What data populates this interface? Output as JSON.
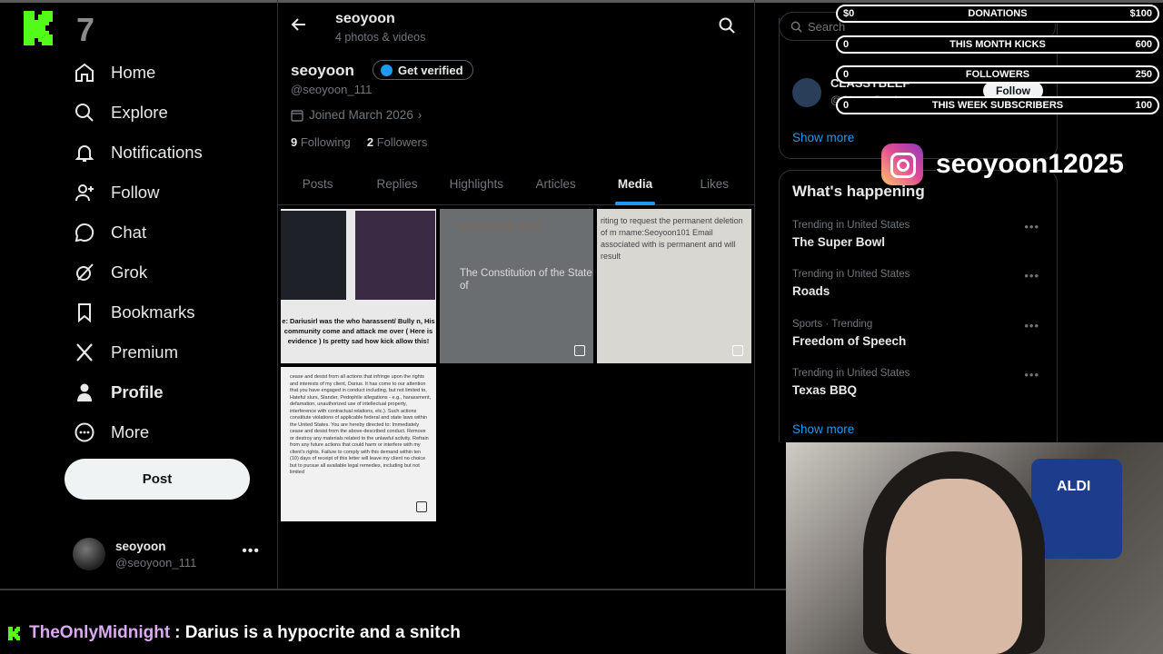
{
  "nav": {
    "items": [
      {
        "label": "Home",
        "icon": "home-icon"
      },
      {
        "label": "Explore",
        "icon": "search-icon"
      },
      {
        "label": "Notifications",
        "icon": "bell-icon"
      },
      {
        "label": "Follow",
        "icon": "add-person-icon"
      },
      {
        "label": "Chat",
        "icon": "chat-icon"
      },
      {
        "label": "Grok",
        "icon": "grok-icon"
      },
      {
        "label": "Bookmarks",
        "icon": "bookmark-icon"
      },
      {
        "label": "Premium",
        "icon": "x-icon"
      },
      {
        "label": "Profile",
        "icon": "person-icon"
      },
      {
        "label": "More",
        "icon": "more-circle-icon"
      }
    ],
    "post_label": "Post",
    "account": {
      "name": "seoyoon",
      "handle": "@seoyoon_111"
    }
  },
  "header": {
    "title": "seoyoon",
    "subtitle": "4 photos & videos"
  },
  "profile": {
    "name": "seoyoon",
    "verify_label": "Get verified",
    "handle": "@seoyoon_111",
    "joined": "Joined March 2026",
    "following_count": "9",
    "following_label": "Following",
    "followers_count": "2",
    "followers_label": "Followers"
  },
  "tabs": [
    "Posts",
    "Replies",
    "Highlights",
    "Articles",
    "Media",
    "Likes"
  ],
  "media": {
    "m1_caption": "e: Dariusirl was the who harassent/ Bully n, His community come and attack me over ( Here is evidence ) Is pretty sad how kick allow this!",
    "m2_title": "and Amendments",
    "m2_text": "The Constitution of the State of",
    "m3_text": "riting to request the permanent deletion of m rname:Seoyoon101 Email associated with is permanent and will result",
    "m4_text": "cease and desist from all actions that infringe upon the rights and interests of my client, Darius. It has come to our attention that you have engaged in conduct including, but not limited to, Hateful slurs, Slander, Pedophile allegations - e.g., harassment, defamation, unauthorized use of intellectual property, interference with contractual relations, etc.). Such actions constitute violations of applicable federal and state laws within the United States. You are hereby directed to: Immediately cease and desist from the above-described conduct. Remove or destroy any materials related to the unlawful activity. Refrain from any future actions that could harm or interfere with my client's rights. Failure to comply with this demand within ten (10) days of receipt of this letter will leave my client no choice but to pursue all available legal remedies, including but not limited"
  },
  "right": {
    "search_placeholder": "Search",
    "suggestion": {
      "name": "CLASSYBEEF",
      "handle": "@ClassyBeef",
      "follow_label": "Follow"
    },
    "show_more": "Show more",
    "happening_title": "What's happening",
    "trends": [
      {
        "context": "Trending in United States",
        "title": "The Super Bowl"
      },
      {
        "context": "Trending in United States",
        "title": "Roads"
      },
      {
        "context": "Sports · Trending",
        "title": "Freedom of Speech"
      },
      {
        "context": "Trending in United States",
        "title": "Texas BBQ"
      }
    ],
    "show_more_2": "Show more"
  },
  "overlay": {
    "goals": [
      {
        "left": "$0",
        "label": "DONATIONS",
        "right": "$100"
      },
      {
        "left": "0",
        "label": "THIS MONTH KICKS",
        "right": "600"
      },
      {
        "left": "0",
        "label": "FOLLOWERS",
        "right": "250"
      },
      {
        "left": "0",
        "label": "THIS WEEK SUBSCRIBERS",
        "right": "100"
      }
    ],
    "instagram": "seoyoon12025",
    "webcam_sign": "ALDI",
    "chat": {
      "user": "TheOnlyMidnight",
      "separator": ": ",
      "message": "Darius is a hypocrite and a snitch"
    }
  },
  "colors": {
    "accent": "#1d9bf0",
    "kick_green": "#53fc18",
    "chat_user": "#d9a9f2"
  }
}
